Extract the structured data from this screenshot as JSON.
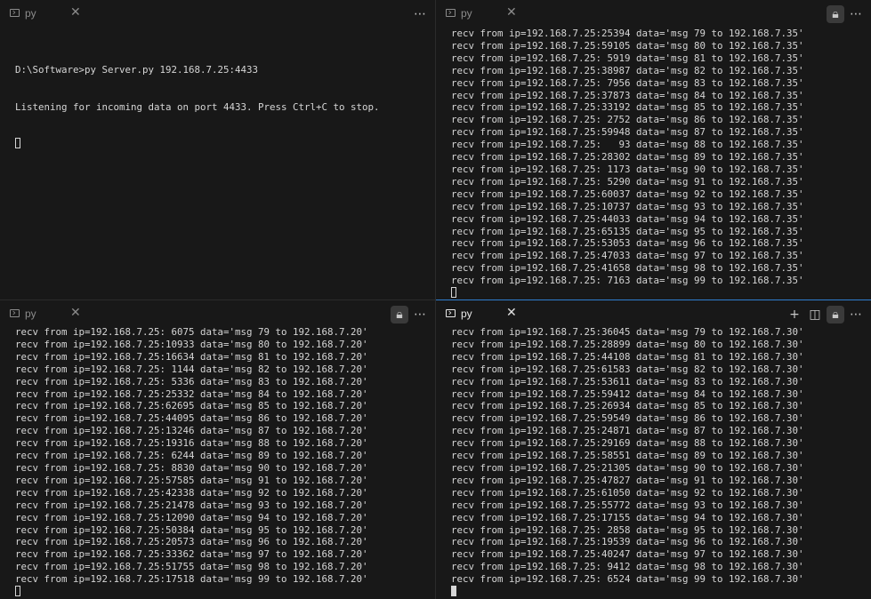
{
  "panes": {
    "top_left": {
      "tab_label": "py",
      "lines": [
        "",
        "D:\\Software>py Server.py 192.168.7.25:4433",
        "Listening for incoming data on port 4433. Press Ctrl+C to stop."
      ]
    },
    "top_right": {
      "tab_label": "py",
      "lines": [
        "recv from ip=192.168.7.25:25394 data='msg 79 to 192.168.7.35'",
        "recv from ip=192.168.7.25:59105 data='msg 80 to 192.168.7.35'",
        "recv from ip=192.168.7.25: 5919 data='msg 81 to 192.168.7.35'",
        "recv from ip=192.168.7.25:38987 data='msg 82 to 192.168.7.35'",
        "recv from ip=192.168.7.25: 7956 data='msg 83 to 192.168.7.35'",
        "recv from ip=192.168.7.25:37873 data='msg 84 to 192.168.7.35'",
        "recv from ip=192.168.7.25:33192 data='msg 85 to 192.168.7.35'",
        "recv from ip=192.168.7.25: 2752 data='msg 86 to 192.168.7.35'",
        "recv from ip=192.168.7.25:59948 data='msg 87 to 192.168.7.35'",
        "recv from ip=192.168.7.25:   93 data='msg 88 to 192.168.7.35'",
        "recv from ip=192.168.7.25:28302 data='msg 89 to 192.168.7.35'",
        "recv from ip=192.168.7.25: 1173 data='msg 90 to 192.168.7.35'",
        "recv from ip=192.168.7.25: 5290 data='msg 91 to 192.168.7.35'",
        "recv from ip=192.168.7.25:60037 data='msg 92 to 192.168.7.35'",
        "recv from ip=192.168.7.25:10737 data='msg 93 to 192.168.7.35'",
        "recv from ip=192.168.7.25:44033 data='msg 94 to 192.168.7.35'",
        "recv from ip=192.168.7.25:65135 data='msg 95 to 192.168.7.35'",
        "recv from ip=192.168.7.25:53053 data='msg 96 to 192.168.7.35'",
        "recv from ip=192.168.7.25:47033 data='msg 97 to 192.168.7.35'",
        "recv from ip=192.168.7.25:41658 data='msg 98 to 192.168.7.35'",
        "recv from ip=192.168.7.25: 7163 data='msg 99 to 192.168.7.35'"
      ]
    },
    "bottom_left": {
      "tab_label": "py",
      "lines": [
        "recv from ip=192.168.7.25: 6075 data='msg 79 to 192.168.7.20'",
        "recv from ip=192.168.7.25:10933 data='msg 80 to 192.168.7.20'",
        "recv from ip=192.168.7.25:16634 data='msg 81 to 192.168.7.20'",
        "recv from ip=192.168.7.25: 1144 data='msg 82 to 192.168.7.20'",
        "recv from ip=192.168.7.25: 5336 data='msg 83 to 192.168.7.20'",
        "recv from ip=192.168.7.25:25332 data='msg 84 to 192.168.7.20'",
        "recv from ip=192.168.7.25:62695 data='msg 85 to 192.168.7.20'",
        "recv from ip=192.168.7.25:44095 data='msg 86 to 192.168.7.20'",
        "recv from ip=192.168.7.25:13246 data='msg 87 to 192.168.7.20'",
        "recv from ip=192.168.7.25:19316 data='msg 88 to 192.168.7.20'",
        "recv from ip=192.168.7.25: 6244 data='msg 89 to 192.168.7.20'",
        "recv from ip=192.168.7.25: 8830 data='msg 90 to 192.168.7.20'",
        "recv from ip=192.168.7.25:57585 data='msg 91 to 192.168.7.20'",
        "recv from ip=192.168.7.25:42338 data='msg 92 to 192.168.7.20'",
        "recv from ip=192.168.7.25:21478 data='msg 93 to 192.168.7.20'",
        "recv from ip=192.168.7.25:12090 data='msg 94 to 192.168.7.20'",
        "recv from ip=192.168.7.25:50384 data='msg 95 to 192.168.7.20'",
        "recv from ip=192.168.7.25:20573 data='msg 96 to 192.168.7.20'",
        "recv from ip=192.168.7.25:33362 data='msg 97 to 192.168.7.20'",
        "recv from ip=192.168.7.25:51755 data='msg 98 to 192.168.7.20'",
        "recv from ip=192.168.7.25:17518 data='msg 99 to 192.168.7.20'"
      ]
    },
    "bottom_right": {
      "tab_label": "py",
      "lines": [
        "recv from ip=192.168.7.25:36045 data='msg 79 to 192.168.7.30'",
        "recv from ip=192.168.7.25:28899 data='msg 80 to 192.168.7.30'",
        "recv from ip=192.168.7.25:44108 data='msg 81 to 192.168.7.30'",
        "recv from ip=192.168.7.25:61583 data='msg 82 to 192.168.7.30'",
        "recv from ip=192.168.7.25:53611 data='msg 83 to 192.168.7.30'",
        "recv from ip=192.168.7.25:59412 data='msg 84 to 192.168.7.30'",
        "recv from ip=192.168.7.25:26934 data='msg 85 to 192.168.7.30'",
        "recv from ip=192.168.7.25:59549 data='msg 86 to 192.168.7.30'",
        "recv from ip=192.168.7.25:24871 data='msg 87 to 192.168.7.30'",
        "recv from ip=192.168.7.25:29169 data='msg 88 to 192.168.7.30'",
        "recv from ip=192.168.7.25:58551 data='msg 89 to 192.168.7.30'",
        "recv from ip=192.168.7.25:21305 data='msg 90 to 192.168.7.30'",
        "recv from ip=192.168.7.25:47827 data='msg 91 to 192.168.7.30'",
        "recv from ip=192.168.7.25:61050 data='msg 92 to 192.168.7.30'",
        "recv from ip=192.168.7.25:55772 data='msg 93 to 192.168.7.30'",
        "recv from ip=192.168.7.25:17155 data='msg 94 to 192.168.7.30'",
        "recv from ip=192.168.7.25: 2858 data='msg 95 to 192.168.7.30'",
        "recv from ip=192.168.7.25:19539 data='msg 96 to 192.168.7.30'",
        "recv from ip=192.168.7.25:40247 data='msg 97 to 192.168.7.30'",
        "recv from ip=192.168.7.25: 9412 data='msg 98 to 192.168.7.30'",
        "recv from ip=192.168.7.25: 6524 data='msg 99 to 192.168.7.30'"
      ]
    }
  },
  "icons": {
    "terminal": "terminal-icon",
    "close": "close-icon",
    "more": "more-actions-icon",
    "lock": "lock-icon",
    "plus": "new-terminal-icon",
    "split": "split-icon"
  },
  "colors": {
    "background": "#181818",
    "text": "#d6d6d6",
    "active_border": "#2f7fd0"
  }
}
